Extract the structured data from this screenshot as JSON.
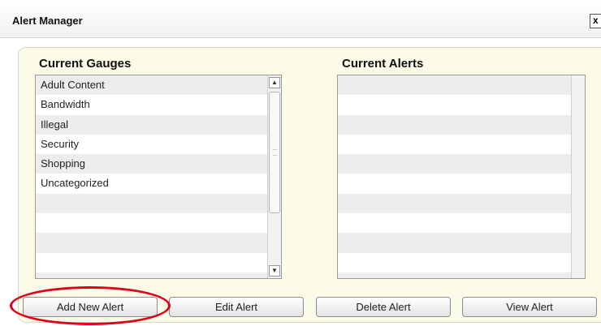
{
  "window": {
    "title": "Alert Manager",
    "close_label": "x"
  },
  "gauges": {
    "label": "Current Gauges",
    "items": [
      {
        "label": "Adult Content"
      },
      {
        "label": "Bandwidth"
      },
      {
        "label": "Illegal"
      },
      {
        "label": "Security"
      },
      {
        "label": "Shopping"
      },
      {
        "label": "Uncategorized"
      }
    ],
    "scroll_up_icon": "triangle-up",
    "scroll_down_icon": "triangle-down"
  },
  "alerts": {
    "label": "Current Alerts",
    "items": []
  },
  "buttons": {
    "add": "Add New Alert",
    "edit": "Edit Alert",
    "delete": "Delete Alert",
    "view": "View Alert"
  },
  "colors": {
    "highlight": "#e0001b",
    "panel_bg": "#fbfbe8"
  }
}
